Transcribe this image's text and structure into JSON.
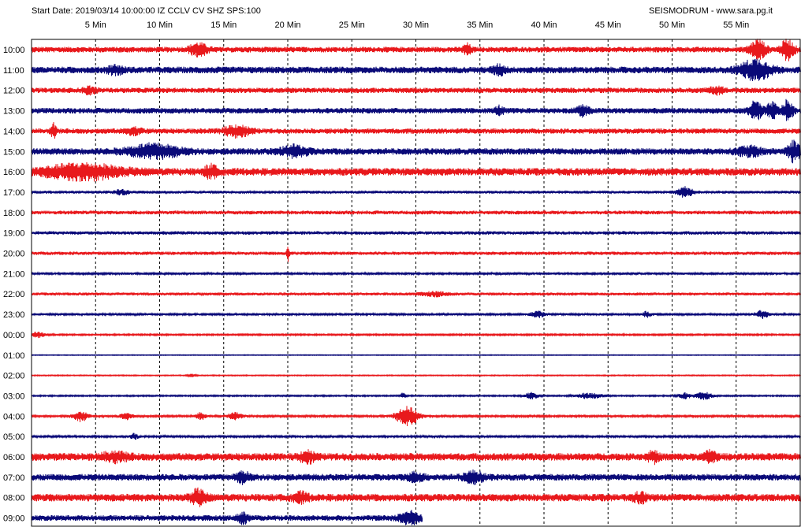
{
  "header": {
    "left": "Start Date: 2019/03/14 10:00:00 IZ CCLV CV SHZ SPS:100",
    "right": "SEISMODRUM - www.sara.pg.it"
  },
  "colors": {
    "odd": "#e8191c",
    "even": "#0a0a78",
    "grid": "#000000",
    "frame": "#000000"
  },
  "chart_data": {
    "type": "line",
    "title": "Start Date: 2019/03/14 10:00:00 IZ CCLV CV SHZ SPS:100",
    "xlabel": "",
    "ylabel": "",
    "x_unit": "Min",
    "xlim": [
      0,
      60
    ],
    "x_ticks": [
      {
        "value": 5,
        "label": "5 Min"
      },
      {
        "value": 10,
        "label": "10 Min"
      },
      {
        "value": 15,
        "label": "15 Min"
      },
      {
        "value": 20,
        "label": "20 Min"
      },
      {
        "value": 25,
        "label": "25 Min"
      },
      {
        "value": 30,
        "label": "30 Min"
      },
      {
        "value": 35,
        "label": "35 Min"
      },
      {
        "value": 40,
        "label": "40 Min"
      },
      {
        "value": 45,
        "label": "45 Min"
      },
      {
        "value": 50,
        "label": "50 Min"
      },
      {
        "value": 55,
        "label": "55 Min"
      }
    ],
    "grid": true,
    "rows": [
      {
        "label": "10:00",
        "color": "#e8191c",
        "noise": 0.3,
        "end_min": 60,
        "events": [
          {
            "t": 13.0,
            "amp": 0.6,
            "dur": 0.7
          },
          {
            "t": 56.7,
            "amp": 1.0,
            "dur": 0.6
          },
          {
            "t": 59.0,
            "amp": 1.0,
            "dur": 0.5
          },
          {
            "t": 34.0,
            "amp": 0.5,
            "dur": 0.3
          }
        ]
      },
      {
        "label": "11:00",
        "color": "#0a0a78",
        "noise": 0.35,
        "end_min": 60,
        "events": [
          {
            "t": 56.5,
            "amp": 1.0,
            "dur": 1.2
          },
          {
            "t": 36.5,
            "amp": 0.4,
            "dur": 0.5
          },
          {
            "t": 6.5,
            "amp": 0.35,
            "dur": 0.6
          }
        ]
      },
      {
        "label": "12:00",
        "color": "#e8191c",
        "noise": 0.28,
        "end_min": 60,
        "events": [
          {
            "t": 4.5,
            "amp": 0.3,
            "dur": 0.5
          },
          {
            "t": 53.5,
            "amp": 0.3,
            "dur": 0.6
          }
        ]
      },
      {
        "label": "13:00",
        "color": "#0a0a78",
        "noise": 0.3,
        "end_min": 60,
        "events": [
          {
            "t": 56.5,
            "amp": 0.9,
            "dur": 0.5
          },
          {
            "t": 57.8,
            "amp": 0.8,
            "dur": 0.4
          },
          {
            "t": 59.0,
            "amp": 1.0,
            "dur": 0.4
          },
          {
            "t": 43.0,
            "amp": 0.45,
            "dur": 0.5
          },
          {
            "t": 36.5,
            "amp": 0.4,
            "dur": 0.3
          }
        ]
      },
      {
        "label": "14:00",
        "color": "#e8191c",
        "noise": 0.28,
        "end_min": 60,
        "events": [
          {
            "t": 1.7,
            "amp": 0.8,
            "dur": 0.2
          },
          {
            "t": 16.0,
            "amp": 0.55,
            "dur": 1.0
          },
          {
            "t": 8.0,
            "amp": 0.3,
            "dur": 0.6
          }
        ]
      },
      {
        "label": "15:00",
        "color": "#0a0a78",
        "noise": 0.35,
        "end_min": 60,
        "events": [
          {
            "t": 9.5,
            "amp": 0.65,
            "dur": 2.0
          },
          {
            "t": 20.5,
            "amp": 0.5,
            "dur": 1.0
          },
          {
            "t": 59.5,
            "amp": 1.0,
            "dur": 0.5
          },
          {
            "t": 56.0,
            "amp": 0.4,
            "dur": 1.0
          }
        ]
      },
      {
        "label": "16:00",
        "color": "#e8191c",
        "noise": 0.4,
        "end_min": 60,
        "events": [
          {
            "t": 4.0,
            "amp": 0.7,
            "dur": 3.0
          },
          {
            "t": 14.0,
            "amp": 0.6,
            "dur": 0.5
          }
        ]
      },
      {
        "label": "17:00",
        "color": "#0a0a78",
        "noise": 0.15,
        "end_min": 60,
        "events": [
          {
            "t": 51.0,
            "amp": 0.5,
            "dur": 0.6
          },
          {
            "t": 7.0,
            "amp": 0.25,
            "dur": 0.5
          }
        ]
      },
      {
        "label": "18:00",
        "color": "#e8191c",
        "noise": 0.2,
        "end_min": 60,
        "events": []
      },
      {
        "label": "19:00",
        "color": "#0a0a78",
        "noise": 0.18,
        "end_min": 60,
        "events": []
      },
      {
        "label": "20:00",
        "color": "#e8191c",
        "noise": 0.18,
        "end_min": 60,
        "events": [
          {
            "t": 20.0,
            "amp": 0.8,
            "dur": 0.1
          }
        ]
      },
      {
        "label": "21:00",
        "color": "#0a0a78",
        "noise": 0.12,
        "end_min": 60,
        "events": []
      },
      {
        "label": "22:00",
        "color": "#e8191c",
        "noise": 0.15,
        "end_min": 60,
        "events": [
          {
            "t": 31.5,
            "amp": 0.2,
            "dur": 1.0
          }
        ]
      },
      {
        "label": "23:00",
        "color": "#0a0a78",
        "noise": 0.12,
        "end_min": 60,
        "events": [
          {
            "t": 39.5,
            "amp": 0.35,
            "dur": 0.5
          },
          {
            "t": 48.0,
            "amp": 0.3,
            "dur": 0.3
          },
          {
            "t": 57.0,
            "amp": 0.4,
            "dur": 0.5
          }
        ]
      },
      {
        "label": "00:00",
        "color": "#e8191c",
        "noise": 0.08,
        "end_min": 60,
        "events": [
          {
            "t": 0.5,
            "amp": 0.3,
            "dur": 0.5
          }
        ]
      },
      {
        "label": "01:00",
        "color": "#0a0a78",
        "noise": 0.04,
        "end_min": 60,
        "events": []
      },
      {
        "label": "02:00",
        "color": "#e8191c",
        "noise": 0.05,
        "end_min": 60,
        "events": [
          {
            "t": 12.5,
            "amp": 0.15,
            "dur": 0.3
          }
        ]
      },
      {
        "label": "03:00",
        "color": "#0a0a78",
        "noise": 0.07,
        "end_min": 60,
        "events": [
          {
            "t": 29.0,
            "amp": 0.3,
            "dur": 0.2
          },
          {
            "t": 39.0,
            "amp": 0.35,
            "dur": 0.5
          },
          {
            "t": 43.5,
            "amp": 0.3,
            "dur": 1.0
          },
          {
            "t": 51.0,
            "amp": 0.3,
            "dur": 0.5
          },
          {
            "t": 52.5,
            "amp": 0.4,
            "dur": 0.6
          }
        ]
      },
      {
        "label": "04:00",
        "color": "#e8191c",
        "noise": 0.1,
        "end_min": 60,
        "events": [
          {
            "t": 3.8,
            "amp": 0.55,
            "dur": 0.6
          },
          {
            "t": 7.4,
            "amp": 0.35,
            "dur": 0.5
          },
          {
            "t": 13.2,
            "amp": 0.35,
            "dur": 0.4
          },
          {
            "t": 15.9,
            "amp": 0.35,
            "dur": 0.6
          },
          {
            "t": 29.3,
            "amp": 1.0,
            "dur": 0.9
          }
        ]
      },
      {
        "label": "05:00",
        "color": "#0a0a78",
        "noise": 0.1,
        "end_min": 60,
        "events": [
          {
            "t": 8.0,
            "amp": 0.3,
            "dur": 0.3
          }
        ]
      },
      {
        "label": "06:00",
        "color": "#e8191c",
        "noise": 0.4,
        "end_min": 60,
        "events": [
          {
            "t": 6.5,
            "amp": 0.4,
            "dur": 1.0
          },
          {
            "t": 21.5,
            "amp": 0.5,
            "dur": 0.6
          },
          {
            "t": 48.5,
            "amp": 0.5,
            "dur": 0.4
          },
          {
            "t": 53.0,
            "amp": 0.6,
            "dur": 0.4
          }
        ]
      },
      {
        "label": "07:00",
        "color": "#0a0a78",
        "noise": 0.35,
        "end_min": 60,
        "events": [
          {
            "t": 16.5,
            "amp": 0.5,
            "dur": 0.5
          },
          {
            "t": 30.0,
            "amp": 0.4,
            "dur": 0.6
          },
          {
            "t": 34.5,
            "amp": 0.5,
            "dur": 0.8
          }
        ]
      },
      {
        "label": "08:00",
        "color": "#e8191c",
        "noise": 0.4,
        "end_min": 60,
        "events": [
          {
            "t": 13.0,
            "amp": 0.7,
            "dur": 0.6
          },
          {
            "t": 21.0,
            "amp": 0.4,
            "dur": 0.6
          },
          {
            "t": 47.5,
            "amp": 0.4,
            "dur": 0.5
          }
        ]
      },
      {
        "label": "09:00",
        "color": "#0a0a78",
        "noise": 0.3,
        "end_min": 30.5,
        "events": [
          {
            "t": 16.5,
            "amp": 0.5,
            "dur": 0.4
          },
          {
            "t": 29.5,
            "amp": 0.6,
            "dur": 0.8
          }
        ]
      }
    ]
  }
}
